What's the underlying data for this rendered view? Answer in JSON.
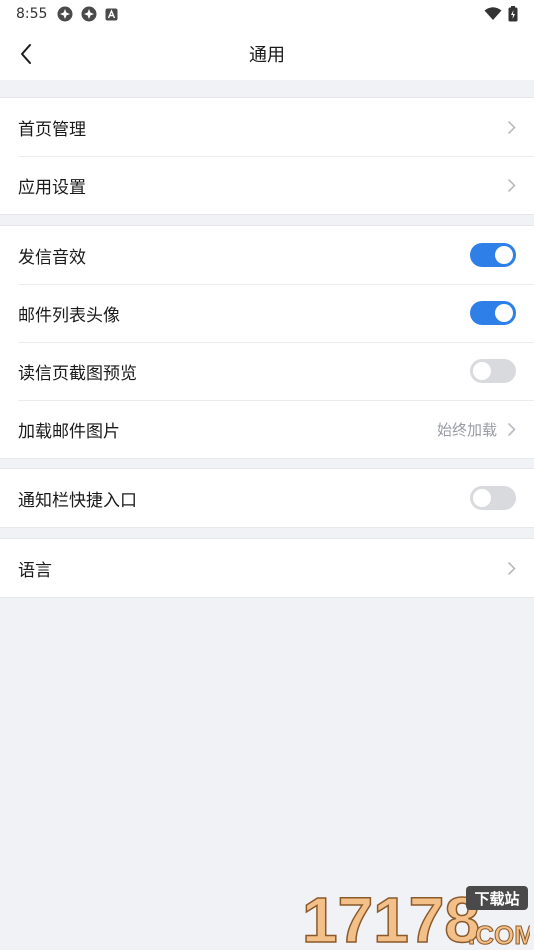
{
  "status_bar": {
    "time": "8:55",
    "icons": [
      "app-icon",
      "app-icon",
      "notification-icon"
    ],
    "right_icons": [
      "wifi-icon",
      "battery-icon"
    ]
  },
  "nav": {
    "title": "通用",
    "back_icon": "chevron-left-icon"
  },
  "groups": [
    {
      "items": [
        {
          "label": "首页管理",
          "type": "link"
        },
        {
          "label": "应用设置",
          "type": "link"
        }
      ]
    },
    {
      "items": [
        {
          "label": "发信音效",
          "type": "toggle",
          "on": true
        },
        {
          "label": "邮件列表头像",
          "type": "toggle",
          "on": true
        },
        {
          "label": "读信页截图预览",
          "type": "toggle",
          "on": false
        },
        {
          "label": "加载邮件图片",
          "type": "link",
          "value": "始终加载"
        }
      ]
    },
    {
      "items": [
        {
          "label": "通知栏快捷入口",
          "type": "toggle",
          "on": false
        }
      ]
    },
    {
      "items": [
        {
          "label": "语言",
          "type": "link"
        }
      ]
    }
  ],
  "colors": {
    "accent": "#2f7fe8",
    "toggle_off": "#d9dadd",
    "background": "#f1f2f5"
  },
  "watermark": {
    "text": "17178",
    "sub": "下载站",
    "domain": ".COM"
  }
}
